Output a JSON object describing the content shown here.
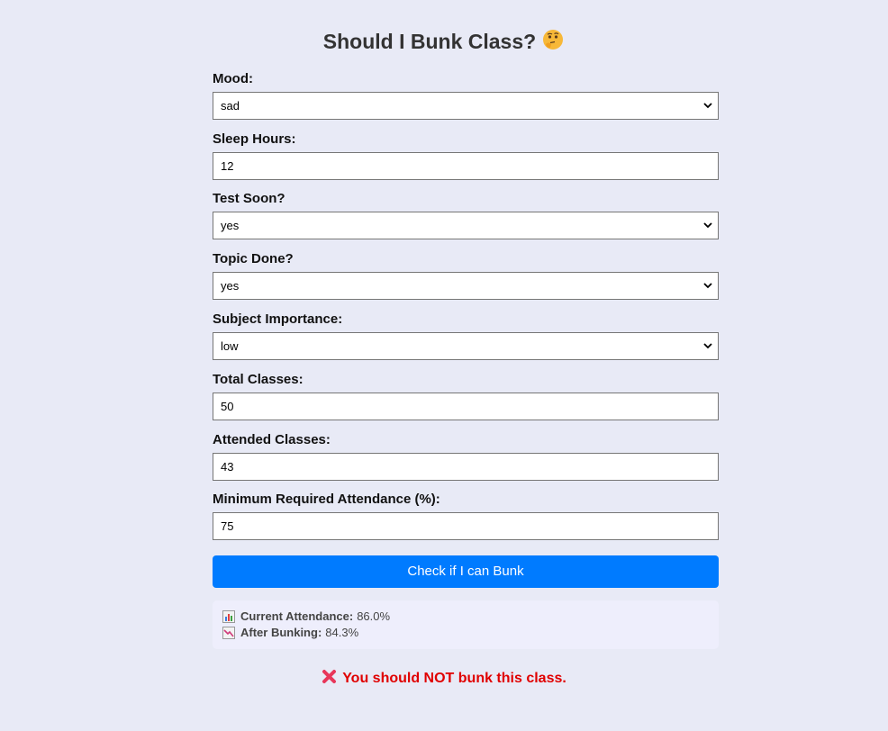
{
  "title": "Should I Bunk Class?",
  "title_icon": "thinking-face-icon",
  "fields": [
    {
      "label": "Mood:",
      "type": "select",
      "value": "sad"
    },
    {
      "label": "Sleep Hours:",
      "type": "input",
      "value": "12"
    },
    {
      "label": "Test Soon?",
      "type": "select",
      "value": "yes"
    },
    {
      "label": "Topic Done?",
      "type": "select",
      "value": "yes"
    },
    {
      "label": "Subject Importance:",
      "type": "select",
      "value": "low"
    },
    {
      "label": "Total Classes:",
      "type": "input",
      "value": "50"
    },
    {
      "label": "Attended Classes:",
      "type": "input",
      "value": "43"
    },
    {
      "label": "Minimum Required Attendance (%):",
      "type": "input",
      "value": "75"
    }
  ],
  "button_label": "Check if I can Bunk",
  "stats": {
    "current_label": "Current Attendance:",
    "current_value": "86.0%",
    "current_icon": "bar-chart-icon",
    "after_label": "After Bunking:",
    "after_value": "84.3%",
    "after_icon": "chart-decreasing-icon"
  },
  "verdict": {
    "icon": "cross-mark-icon",
    "text": "You should NOT bunk this class."
  },
  "colors": {
    "background": "#e8eaf6",
    "button": "#007bff",
    "verdict": "#e00000",
    "stats_bg": "#eeeefc"
  }
}
